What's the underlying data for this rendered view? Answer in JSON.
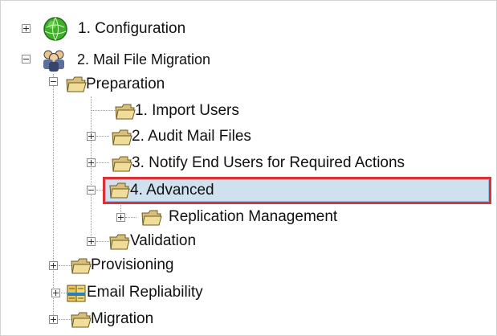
{
  "tree": {
    "configuration": {
      "label": "1. Configuration",
      "icon": "globe-icon",
      "expander": "plus"
    },
    "mail_file_migration": {
      "label": "2. Mail File Migration",
      "icon": "users-group-icon",
      "expander": "minus"
    },
    "preparation": {
      "label": "Preparation",
      "icon": "folder-icon",
      "expander": "minus"
    },
    "import_users": {
      "label": "1. Import Users",
      "icon": "folder-icon"
    },
    "audit_mail_files": {
      "label": "2. Audit Mail Files",
      "icon": "folder-icon",
      "expander": "plus"
    },
    "notify_end_users": {
      "label": "3. Notify End Users for Required Actions",
      "icon": "folder-icon",
      "expander": "plus"
    },
    "advanced": {
      "label": "4. Advanced",
      "icon": "folder-icon",
      "expander": "minus",
      "selected": true
    },
    "replication_management": {
      "label": "Replication Management",
      "icon": "folder-icon",
      "expander": "plus"
    },
    "validation": {
      "label": "Validation",
      "icon": "folder-icon",
      "expander": "plus"
    },
    "provisioning": {
      "label": "Provisioning",
      "icon": "folder-icon",
      "expander": "plus"
    },
    "email_repliability": {
      "label": "Email Repliability",
      "icon": "ledger-icon",
      "expander": "plus"
    },
    "migration": {
      "label": "Migration",
      "icon": "folder-icon",
      "expander": "plus"
    }
  },
  "colors": {
    "highlight_border": "#d7343a",
    "selection_fill": "#cfe0ef",
    "folder": "#d9c07a"
  }
}
